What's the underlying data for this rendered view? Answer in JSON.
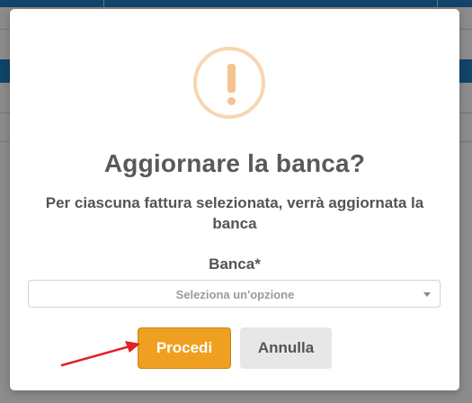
{
  "dialog": {
    "title": "Aggiornare la banca?",
    "message": "Per ciascuna fattura selezionata, verrà aggiornata la banca",
    "icon": "warning-icon",
    "field": {
      "label": "Banca*",
      "placeholder": "Seleziona un'opzione"
    },
    "buttons": {
      "confirm_label": "Procedi",
      "cancel_label": "Annulla"
    }
  },
  "colors": {
    "confirm_button": "#f0a021",
    "cancel_button": "#e7e7e7",
    "warning_icon": "#f6c28f",
    "annotation_arrow": "#e32222",
    "background_header": "#1f7fc0"
  }
}
